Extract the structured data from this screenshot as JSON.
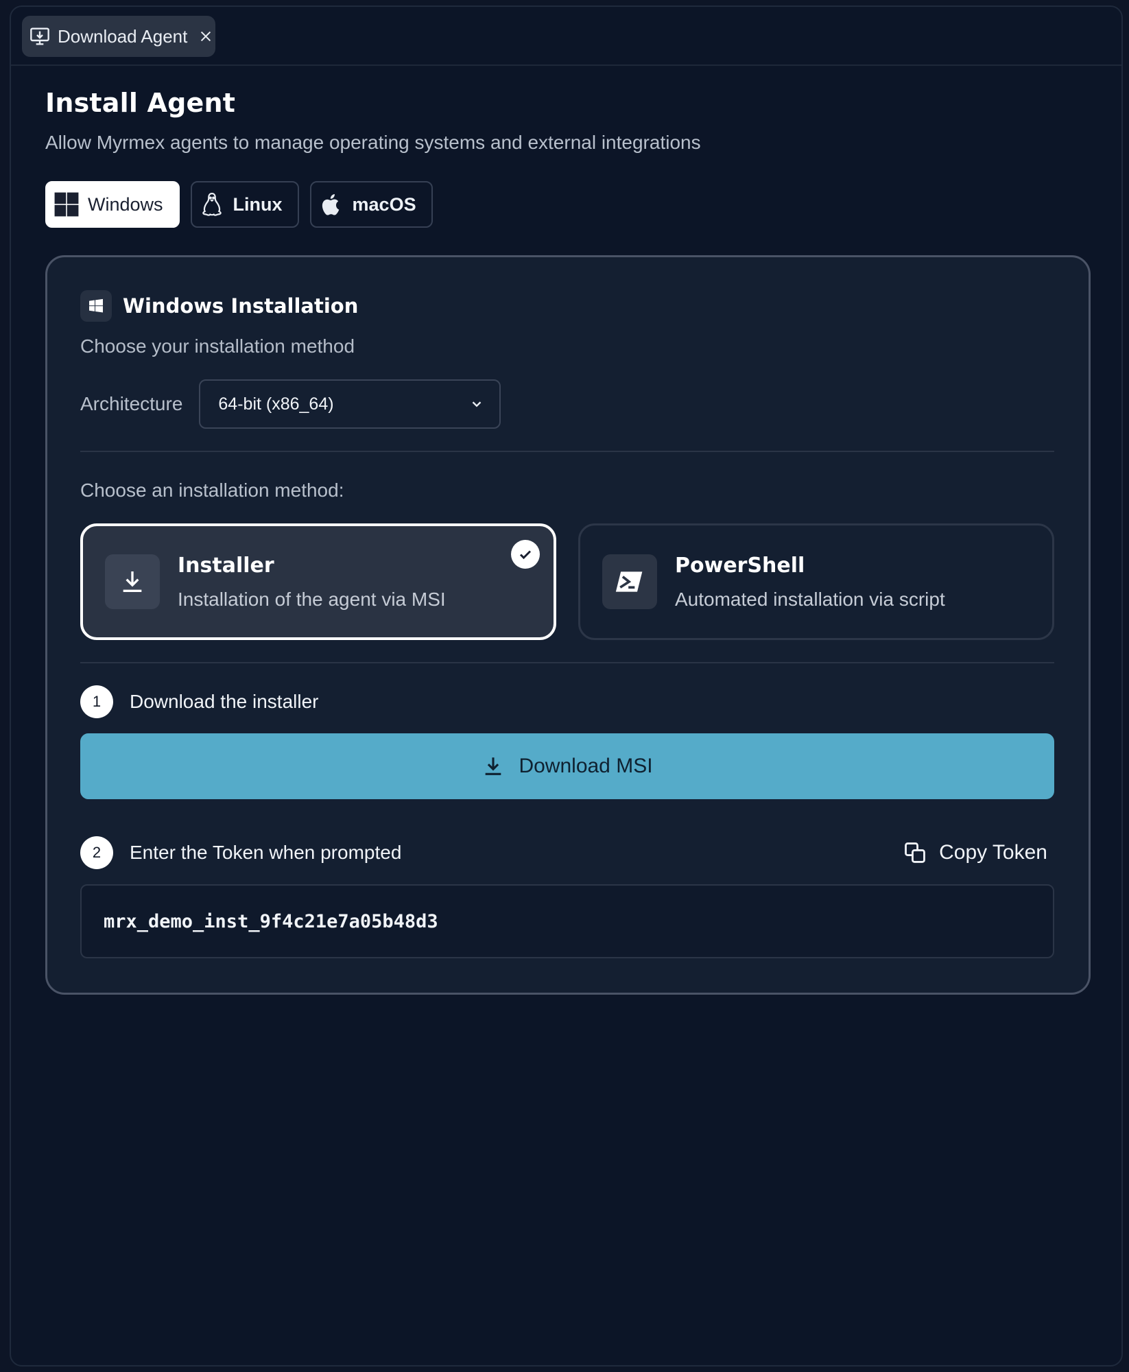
{
  "tab": {
    "label": "Download Agent"
  },
  "page": {
    "title": "Install Agent",
    "subtitle": "Allow Myrmex agents to manage operating systems and external integrations"
  },
  "os_tabs": [
    {
      "label": "Windows",
      "icon": "windows-icon",
      "active": true
    },
    {
      "label": "Linux",
      "icon": "linux-icon",
      "active": false
    },
    {
      "label": "macOS",
      "icon": "apple-icon",
      "active": false
    }
  ],
  "card": {
    "title": "Windows Installation",
    "subtitle": "Choose your installation method",
    "architecture_label": "Architecture",
    "architecture_value": "64-bit (x86_64)",
    "method_label": "Choose an installation method:",
    "methods": [
      {
        "title": "Installer",
        "desc": "Installation of the agent via MSI",
        "selected": true
      },
      {
        "title": "PowerShell",
        "desc": "Automated installation via script",
        "selected": false
      }
    ],
    "step1": {
      "num": "1",
      "text": "Download the installer",
      "button": "Download MSI"
    },
    "step2": {
      "num": "2",
      "text": "Enter the Token when prompted",
      "copy_label": "Copy Token",
      "token": "mrx_demo_inst_9f4c21e7a05b48d3"
    }
  },
  "colors": {
    "accent": "#55abc9",
    "background": "#0c1527",
    "card": "#141f31"
  }
}
